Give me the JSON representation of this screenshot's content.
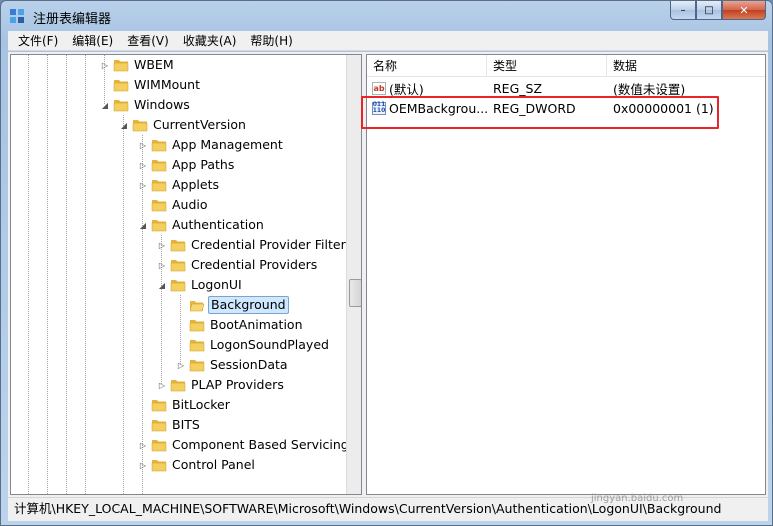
{
  "window": {
    "title": "注册表编辑器",
    "buttons": {
      "minimize": "–",
      "maximize": "□",
      "close": "✕"
    }
  },
  "menubar": {
    "items": [
      "文件(F)",
      "编辑(E)",
      "查看(V)",
      "收藏夹(A)",
      "帮助(H)"
    ]
  },
  "tree": {
    "items": [
      {
        "label": "WBEM",
        "expander": "collapsed"
      },
      {
        "label": "WIMMount",
        "expander": "none"
      },
      {
        "label": "Windows",
        "expander": "expanded"
      },
      {
        "label": "CurrentVersion",
        "expander": "expanded"
      },
      {
        "label": "App Management",
        "expander": "collapsed"
      },
      {
        "label": "App Paths",
        "expander": "collapsed"
      },
      {
        "label": "Applets",
        "expander": "collapsed"
      },
      {
        "label": "Audio",
        "expander": "none"
      },
      {
        "label": "Authentication",
        "expander": "expanded"
      },
      {
        "label": "Credential Provider Filters",
        "expander": "collapsed"
      },
      {
        "label": "Credential Providers",
        "expander": "collapsed"
      },
      {
        "label": "LogonUI",
        "expander": "expanded"
      },
      {
        "label": "Background",
        "expander": "none",
        "selected": true
      },
      {
        "label": "BootAnimation",
        "expander": "none"
      },
      {
        "label": "LogonSoundPlayed",
        "expander": "none"
      },
      {
        "label": "SessionData",
        "expander": "collapsed"
      },
      {
        "label": "PLAP Providers",
        "expander": "collapsed"
      },
      {
        "label": "BitLocker",
        "expander": "none"
      },
      {
        "label": "BITS",
        "expander": "none"
      },
      {
        "label": "Component Based Servicing",
        "expander": "collapsed"
      },
      {
        "label": "Control Panel",
        "expander": "collapsed"
      }
    ]
  },
  "list": {
    "columns": [
      "名称",
      "类型",
      "数据"
    ],
    "rows": [
      {
        "name": "(默认)",
        "type": "REG_SZ",
        "data": "(数值未设置)",
        "icon": "ab"
      },
      {
        "name": "OEMBackgrou...",
        "type": "REG_DWORD",
        "data": "0x00000001 (1)",
        "icon": "dword"
      }
    ]
  },
  "statusbar": {
    "path": "计算机\\HKEY_LOCAL_MACHINE\\SOFTWARE\\Microsoft\\Windows\\CurrentVersion\\Authentication\\LogonUI\\Background"
  },
  "watermark": {
    "brand": "Bai 经验",
    "url": "jingyan.baidu.com"
  },
  "colors": {
    "highlight": "#e8262a",
    "selection": "#cde8ff",
    "folder": "#f5c84b"
  }
}
